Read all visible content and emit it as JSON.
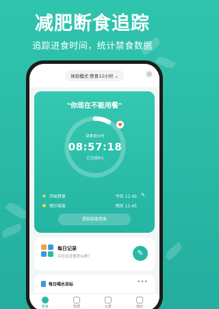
{
  "header": {
    "title": "减肥断食追踪",
    "subtitle": "追踪进食时间，统计禁食数据"
  },
  "app": {
    "mode": "体验模式·禁食12小时 ⌄",
    "quote": "\"你现在不能用餐\"",
    "ring": {
      "label": "禁食倒计时",
      "time": "08:57:18",
      "done": "已完成8%",
      "progress": 0.08
    },
    "start": {
      "label": "开始禁食",
      "value": "今天 11:45"
    },
    "end": {
      "label": "预计结束",
      "value": "明天 11:45"
    },
    "end_button": "提前结束禁食",
    "record": {
      "title": "每日记录",
      "subtitle": "今日天过得怎么样？"
    },
    "water": {
      "title": "每日喝水目标",
      "more": "•••"
    },
    "tabs": [
      {
        "label": "禁食"
      },
      {
        "label": "数据"
      },
      {
        "label": "记录"
      },
      {
        "label": "我的"
      }
    ],
    "colors": {
      "accent": "#27b9a6",
      "start_dot": "#a6e35a",
      "end_dot": "#f5d24a",
      "flame": "#f07a3a"
    }
  }
}
